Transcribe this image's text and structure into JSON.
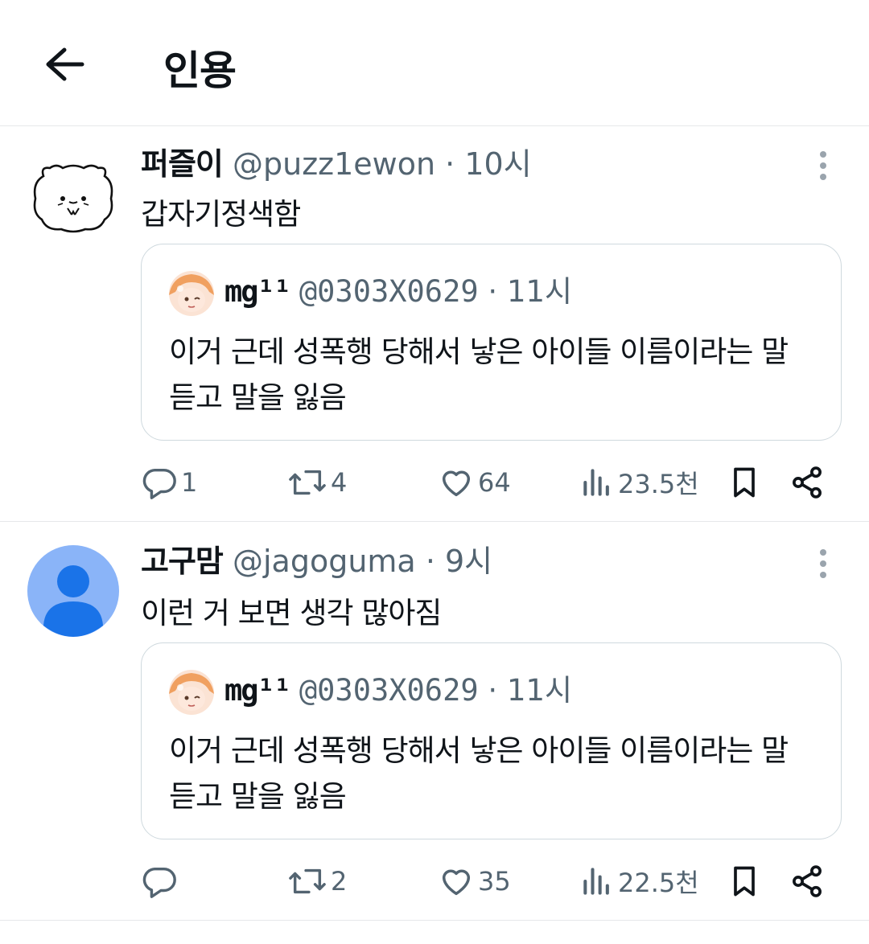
{
  "header": {
    "title": "인용"
  },
  "tweets": [
    {
      "name": "퍼즐이",
      "handle": "@puzz1ewon",
      "dot": "·",
      "time": "10시",
      "text": "갑자기정색함",
      "quote": {
        "name": "mg¹¹",
        "handle": "@0303X0629",
        "dot": "·",
        "time": "11시",
        "text": "이거 근데 성폭행 당해서 낳은 아이들 이름이라는 말 듣고 말을 잃음"
      },
      "stats": {
        "replies": "1",
        "retweets": "4",
        "likes": "64",
        "views": "23.5천"
      }
    },
    {
      "name": "고구맘",
      "handle": "@jagoguma",
      "dot": "·",
      "time": "9시",
      "text": "이런 거 보면 생각 많아짐",
      "quote": {
        "name": "mg¹¹",
        "handle": "@0303X0629",
        "dot": "·",
        "time": "11시",
        "text": "이거 근데 성폭행 당해서 낳은 아이들 이름이라는 말 듣고 말을 잃음"
      },
      "stats": {
        "replies": "",
        "retweets": "2",
        "likes": "35",
        "views": "22.5천"
      }
    }
  ],
  "icons": {
    "back": "arrow-left-icon",
    "more": "more-vertical-icon",
    "reply": "reply-icon",
    "retweet": "retweet-icon",
    "like": "heart-icon",
    "views": "views-icon",
    "bookmark": "bookmark-icon",
    "share": "share-icon"
  },
  "colors": {
    "text": "#0f1419",
    "secondary": "#536471",
    "border": "#cfd9de",
    "default_avatar_bg": "#8ab4f8",
    "default_avatar_fg": "#1a73e8"
  }
}
